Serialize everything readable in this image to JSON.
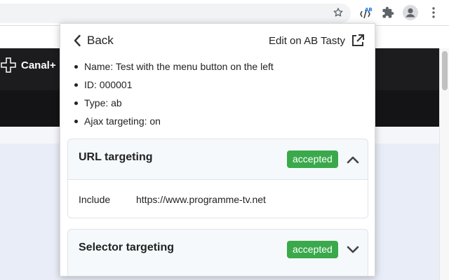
{
  "browser": {
    "icons": [
      "star-icon",
      "ab-tasty-extension-icon",
      "puzzle-icon",
      "profile-icon",
      "menu-icon"
    ]
  },
  "site": {
    "logo_text": "Canal+"
  },
  "popup": {
    "back_label": "Back",
    "edit_label": "Edit on AB Tasty",
    "info": {
      "name": "Name: Test with the menu button on the left",
      "id": "ID: 000001",
      "type": "Type: ab",
      "ajax": "Ajax targeting: on"
    },
    "url_targeting": {
      "title": "URL targeting",
      "status": "accepted",
      "expanded": true,
      "row_key": "Include",
      "row_value": "https://www.programme-tv.net"
    },
    "selector_targeting": {
      "title": "Selector targeting",
      "status": "accepted",
      "expanded": false
    }
  },
  "colors": {
    "accepted_badge": "#3aa94b",
    "card_background": "#f5f9fc"
  }
}
